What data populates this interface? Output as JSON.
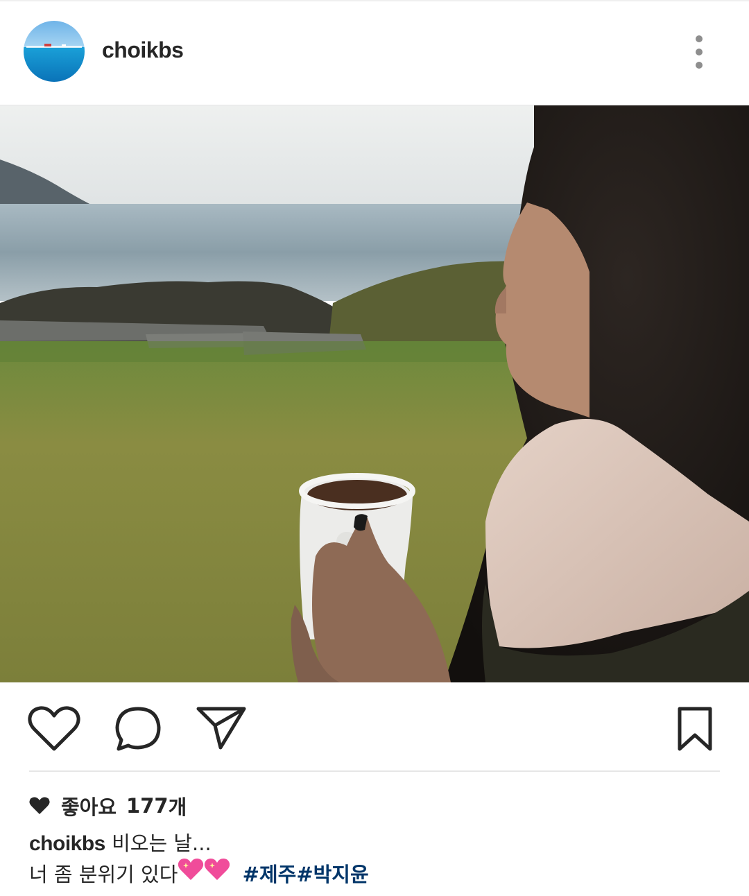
{
  "post": {
    "username": "choikbs",
    "likes_label": "좋아요",
    "likes_count": "177",
    "likes_unit": "개",
    "caption_user": "choikbs",
    "caption_line1": "비오는 날...",
    "caption_line2": "너 좀 분위기 있다",
    "caption_emoji": "💖💖",
    "hashtags": [
      "#제주",
      "#박지윤"
    ]
  },
  "icons": {
    "more": "more-vertical-icon",
    "like": "heart-icon",
    "comment": "comment-icon",
    "share": "send-icon",
    "save": "bookmark-icon"
  },
  "colors": {
    "text": "#262626",
    "hashtag": "#003569",
    "icon": "#262626",
    "divider": "#e6e6e6"
  }
}
